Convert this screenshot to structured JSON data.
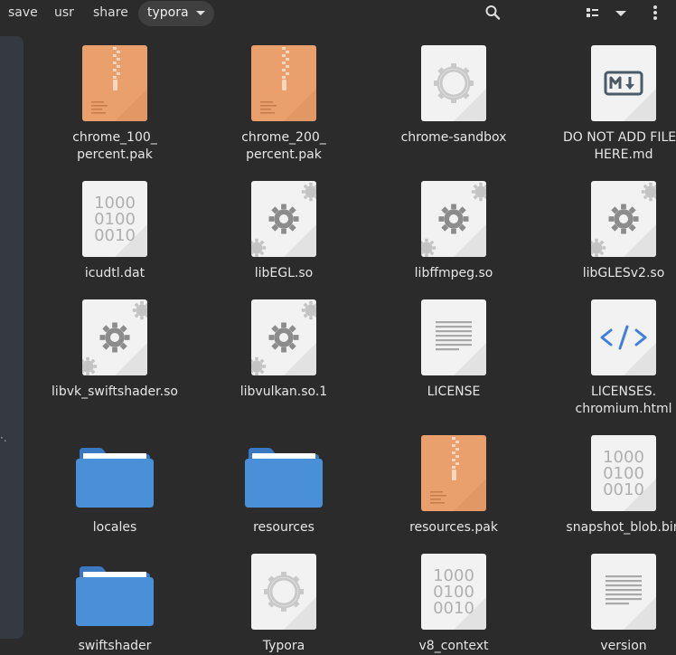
{
  "breadcrumbs": [
    {
      "label": "save"
    },
    {
      "label": "usr"
    },
    {
      "label": "share"
    },
    {
      "label": "typora"
    }
  ],
  "toolbar": {
    "search_icon": "search-icon",
    "view_icon": "list-view-icon",
    "sort_icon": "chevron-down-icon",
    "menu_icon": "kebab-menu-icon"
  },
  "sidebar": {
    "dots": "·."
  },
  "files": [
    {
      "name": "chrome_100_\npercent.pak",
      "icon": "archive-icon"
    },
    {
      "name": "chrome_200_\npercent.pak",
      "icon": "archive-icon"
    },
    {
      "name": "chrome-sandbox",
      "icon": "executable-icon"
    },
    {
      "name": "DO NOT ADD FILES\nHERE.md",
      "icon": "markdown-icon"
    },
    {
      "name": "icudtl.dat",
      "icon": "binary-icon"
    },
    {
      "name": "libEGL.so",
      "icon": "library-icon"
    },
    {
      "name": "libffmpeg.so",
      "icon": "library-icon"
    },
    {
      "name": "libGLESv2.so",
      "icon": "library-icon"
    },
    {
      "name": "libvk_swiftshader.so",
      "icon": "library-icon"
    },
    {
      "name": "libvulkan.so.1",
      "icon": "library-icon"
    },
    {
      "name": "LICENSE",
      "icon": "text-icon"
    },
    {
      "name": "LICENSES.\nchromium.html",
      "icon": "html-icon"
    },
    {
      "name": "locales",
      "icon": "folder-icon"
    },
    {
      "name": "resources",
      "icon": "folder-icon"
    },
    {
      "name": "resources.pak",
      "icon": "archive-icon"
    },
    {
      "name": "snapshot_blob.bin",
      "icon": "binary-icon"
    },
    {
      "name": "swiftshader",
      "icon": "folder-icon"
    },
    {
      "name": "Typora",
      "icon": "executable-icon"
    },
    {
      "name": "v8_context",
      "icon": "binary-icon"
    },
    {
      "name": "version",
      "icon": "text-icon"
    }
  ],
  "binary_digits": [
    "1000",
    "0100",
    "0010"
  ],
  "colors": {
    "background": "#2b2b2b",
    "folder": "#4a90d9",
    "archive": "#e9a06c",
    "html": "#3f7fe0"
  }
}
